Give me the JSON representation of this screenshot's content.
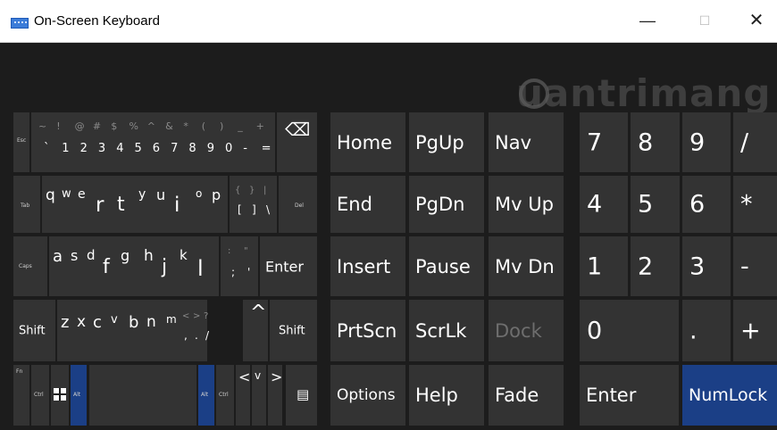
{
  "window": {
    "title": "On-Screen Keyboard",
    "minimize": "—",
    "maximize": "☐",
    "close": "✕"
  },
  "watermark": "uantrimang",
  "left": {
    "row1": {
      "esc": "Esc",
      "shifted": [
        "~",
        "!",
        "@",
        "#",
        "$",
        "%",
        "^",
        "&",
        "*",
        "(",
        ")",
        "_",
        "+"
      ],
      "chars": [
        "`",
        "1",
        "2",
        "3",
        "4",
        "5",
        "6",
        "7",
        "8",
        "9",
        "0",
        "-",
        "="
      ],
      "backspace": "⌫"
    },
    "row2": {
      "tab": "Tab",
      "keys": [
        "q",
        "w",
        "e",
        "r",
        "t",
        "y",
        "u",
        "i",
        "o",
        "p"
      ],
      "bracket_shift": [
        "{",
        "}",
        "|"
      ],
      "bracket_chars": [
        "[",
        "]",
        "\\"
      ],
      "del": "Del"
    },
    "row3": {
      "caps": "Caps",
      "keys": [
        "a",
        "s",
        "d",
        "f",
        "g",
        "h",
        "j",
        "k",
        "l"
      ],
      "punct_shift": [
        ":",
        "\""
      ],
      "punct_chars": [
        ";",
        "'"
      ],
      "enter": "Enter"
    },
    "row4": {
      "shift_left": "Shift",
      "keys": [
        "z",
        "x",
        "c",
        "v",
        "b",
        "n",
        "m"
      ],
      "punct_shift": [
        "<",
        ">",
        "?"
      ],
      "punct_chars": [
        ",",
        ".",
        "/"
      ],
      "up": "^",
      "shift_right": "Shift"
    },
    "row5": {
      "fn": "Fn",
      "ctrl": "Ctrl",
      "alt": "Alt",
      "left": "<",
      "down": "v",
      "right": ">",
      "menu": "▤"
    }
  },
  "nav": {
    "row1": [
      "Home",
      "PgUp",
      "Nav"
    ],
    "row2": [
      "End",
      "PgDn",
      "Mv Up"
    ],
    "row3": [
      "Insert",
      "Pause",
      "Mv Dn"
    ],
    "row4": [
      "PrtScn",
      "ScrLk",
      "Dock"
    ],
    "row5": [
      "Options",
      "Help",
      "Fade"
    ]
  },
  "numpad": {
    "row1": [
      "7",
      "8",
      "9",
      "/"
    ],
    "row2": [
      "4",
      "5",
      "6",
      "*"
    ],
    "row3": [
      "1",
      "2",
      "3",
      "-"
    ],
    "row4": [
      "0",
      ".",
      "+"
    ],
    "row5": [
      "Enter",
      "NumLock"
    ]
  },
  "colors": {
    "bg": "#1c1c1c",
    "key": "#333333",
    "accent": "#1b3f86"
  }
}
